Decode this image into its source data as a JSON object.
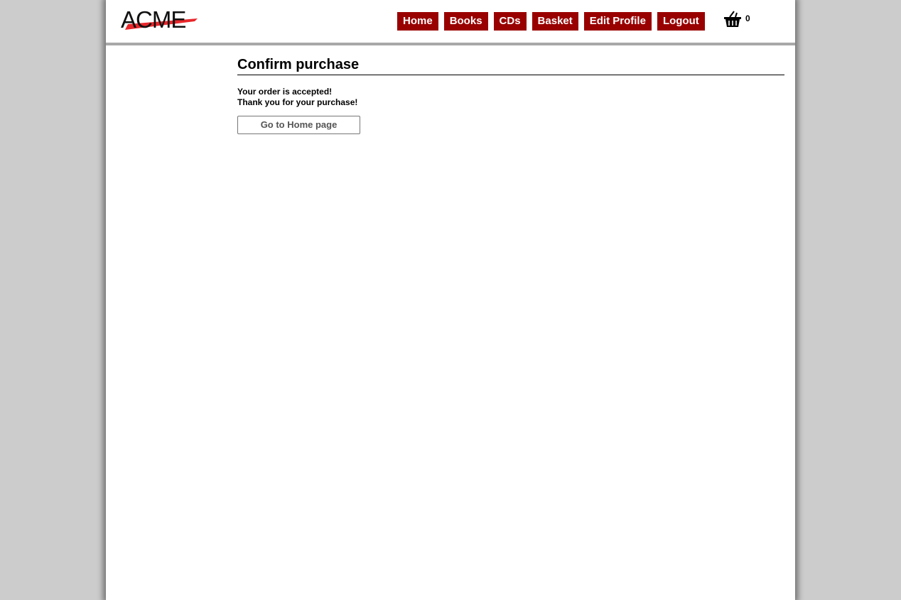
{
  "header": {
    "logo_text": "ACME",
    "nav": [
      "Home",
      "Books",
      "CDs",
      "Basket",
      "Edit Profile",
      "Logout"
    ],
    "basket_count": "0"
  },
  "main": {
    "title": "Confirm purchase",
    "message_line1": "Your order is accepted!",
    "message_line2": "Thank you for your purchase!",
    "home_button": "Go to Home page"
  },
  "colors": {
    "nav_bg": "#990000",
    "nav_text": "#ffffff",
    "logo_accent": "#e8262b",
    "page_bg": "#cccccc"
  },
  "icons": {
    "basket": "basket-icon",
    "logo": "acme-logo"
  }
}
